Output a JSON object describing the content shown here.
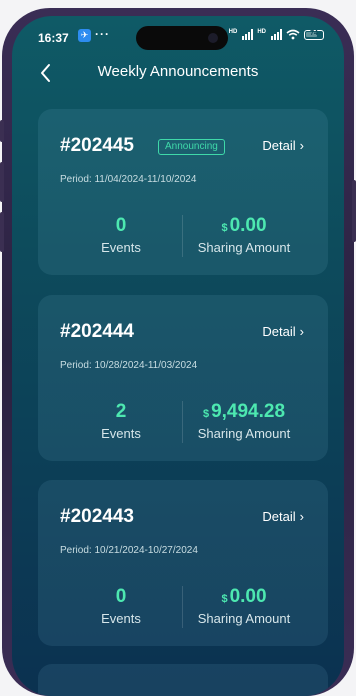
{
  "status_bar": {
    "time": "16:37",
    "app_icon_glyph": "✈",
    "dots": "···",
    "sig1_label": "HD",
    "sig2_label": "HD",
    "battery_level": "74"
  },
  "header": {
    "title": "Weekly Announcements",
    "back_icon": "chevron-left-icon"
  },
  "cards": [
    {
      "number": "#202445",
      "badge": "Announcing",
      "detail_label": "Detail",
      "period": "Period: 11/04/2024-11/10/2024",
      "events": "0",
      "events_label": "Events",
      "currency": "$",
      "amount": "0.00",
      "amount_label": "Sharing Amount"
    },
    {
      "number": "#202444",
      "detail_label": "Detail",
      "period": "Period: 10/28/2024-11/03/2024",
      "events": "2",
      "events_label": "Events",
      "currency": "$",
      "amount": "9,494.28",
      "amount_label": "Sharing Amount"
    },
    {
      "number": "#202443",
      "detail_label": "Detail",
      "period": "Period: 10/21/2024-10/27/2024",
      "events": "0",
      "events_label": "Events",
      "currency": "$",
      "amount": "0.00",
      "amount_label": "Sharing Amount"
    }
  ],
  "colors": {
    "accent_green": "#4de8b0",
    "badge_green": "#3fd9a9",
    "background_top": "#0f5a66",
    "background_bottom": "#0b3150"
  }
}
